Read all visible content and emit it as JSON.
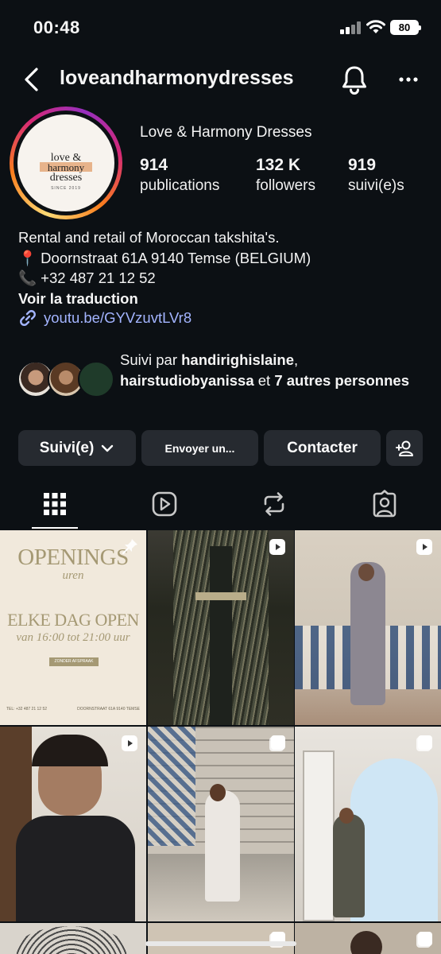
{
  "status_bar": {
    "time": "00:48",
    "battery": "80"
  },
  "header": {
    "username": "loveandharmonydresses"
  },
  "profile": {
    "display_name": "Love & Harmony Dresses",
    "logo": {
      "line1": "love &",
      "line2": "harmony",
      "line3": "dresses",
      "since": "SINCE 2019"
    },
    "stats": [
      {
        "value": "914",
        "label": "publications"
      },
      {
        "value": "132 K",
        "label": "followers"
      },
      {
        "value": "919",
        "label": "suivi(e)s"
      }
    ],
    "bio": [
      "Rental and retail of Moroccan takshita's.",
      "📍 Doornstraat 61A 9140 Temse (BELGIUM)",
      "📞 +32 487 21 12 52"
    ],
    "translate": "Voir la traduction",
    "link": "youtu.be/GYVzuvtLVr8"
  },
  "followed_by": {
    "prefix": "Suivi par ",
    "user1": "handirighislaine",
    "sep": ",",
    "user2": "hairstudiobyanissa",
    "middle": " et ",
    "others": "7 autres personnes"
  },
  "buttons": {
    "follow": "Suivi(e)",
    "message": "Envoyer un...",
    "contact": "Contacter"
  },
  "tabs": [
    "grid",
    "reels",
    "reposts",
    "tagged"
  ],
  "grid_posts": {
    "p1": {
      "title": "OPENINGS",
      "subtitle": "uren",
      "headline": "ELKE DAG OPEN",
      "time": "van 16:00 tot 21:00 uur",
      "pill": "ZONDER AFSPRAAK",
      "tel": "TEL: +32 487 21 12 52",
      "address": "DOORNSTRAAT 61A 9140 TEMSE"
    }
  }
}
